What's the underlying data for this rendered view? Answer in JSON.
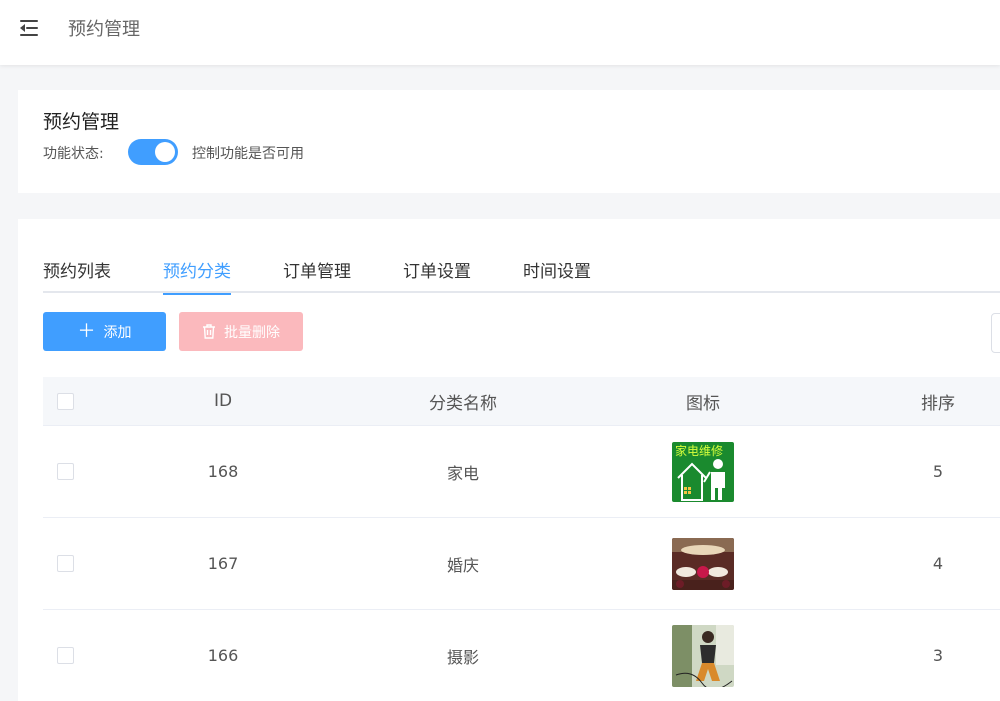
{
  "header": {
    "title": "预约管理",
    "menu_icon": "menu-fold-icon"
  },
  "settings_card": {
    "title": "预约管理",
    "status_label": "功能状态:",
    "switch_on": true,
    "hint": "控制功能是否可用"
  },
  "tabs": [
    {
      "label": "预约列表",
      "active": false
    },
    {
      "label": "预约分类",
      "active": true
    },
    {
      "label": "订单管理",
      "active": false
    },
    {
      "label": "订单设置",
      "active": false
    },
    {
      "label": "时间设置",
      "active": false
    }
  ],
  "toolbar": {
    "add_label": "添加",
    "add_icon": "plus-icon",
    "batch_delete_label": "批量删除",
    "batch_delete_icon": "trash-icon"
  },
  "table": {
    "columns": [
      "ID",
      "分类名称",
      "图标",
      "排序"
    ],
    "rows": [
      {
        "id": "168",
        "name": "家电",
        "sort": "5",
        "icon_text": "家电维修",
        "icon": "appliance-repair-image"
      },
      {
        "id": "167",
        "name": "婚庆",
        "sort": "4",
        "icon": "wedding-banquet-image"
      },
      {
        "id": "166",
        "name": "摄影",
        "sort": "3",
        "icon": "photography-image"
      }
    ]
  },
  "colors": {
    "primary": "#409eff",
    "danger_light": "#fbb9bd",
    "header_bg": "#f5f7fa"
  }
}
